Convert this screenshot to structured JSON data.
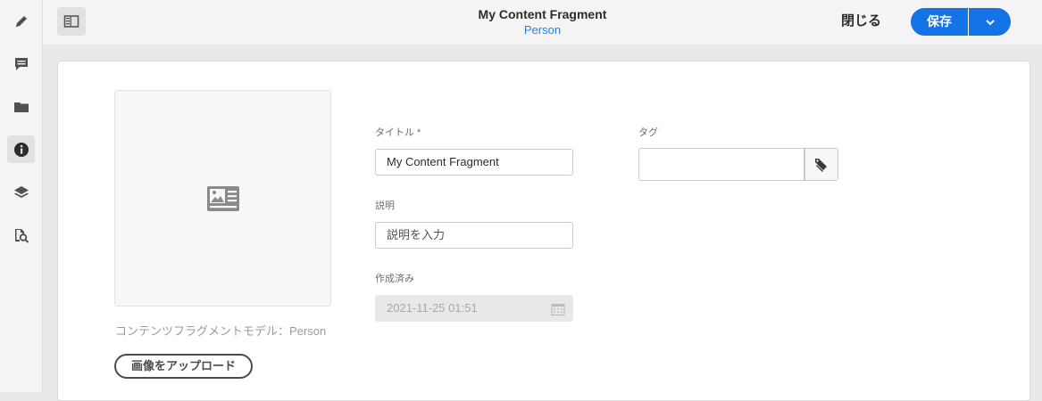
{
  "header": {
    "title": "My Content Fragment",
    "subtitle": "Person",
    "close_label": "閉じる",
    "save_label": "保存"
  },
  "rail": {
    "items": [
      {
        "icon": "pencil-icon"
      },
      {
        "icon": "comment-icon"
      },
      {
        "icon": "folder-icon"
      },
      {
        "icon": "info-icon",
        "active": true
      },
      {
        "icon": "layers-icon"
      },
      {
        "icon": "search-references-icon"
      }
    ]
  },
  "main": {
    "thumbnail_icon": "image-card-icon",
    "model_label": "コンテンツフラグメントモデル：Person",
    "upload_label": "画像をアップロード",
    "fields": {
      "title_label": "タイトル *",
      "title_value": "My Content Fragment",
      "description_label": "説明",
      "description_placeholder": "説明を入力",
      "created_label": "作成済み",
      "created_value": "2021-11-25 01:51",
      "tags_label": "タグ"
    }
  },
  "colors": {
    "accent": "#1473e6",
    "subtitle": "#2680eb"
  }
}
